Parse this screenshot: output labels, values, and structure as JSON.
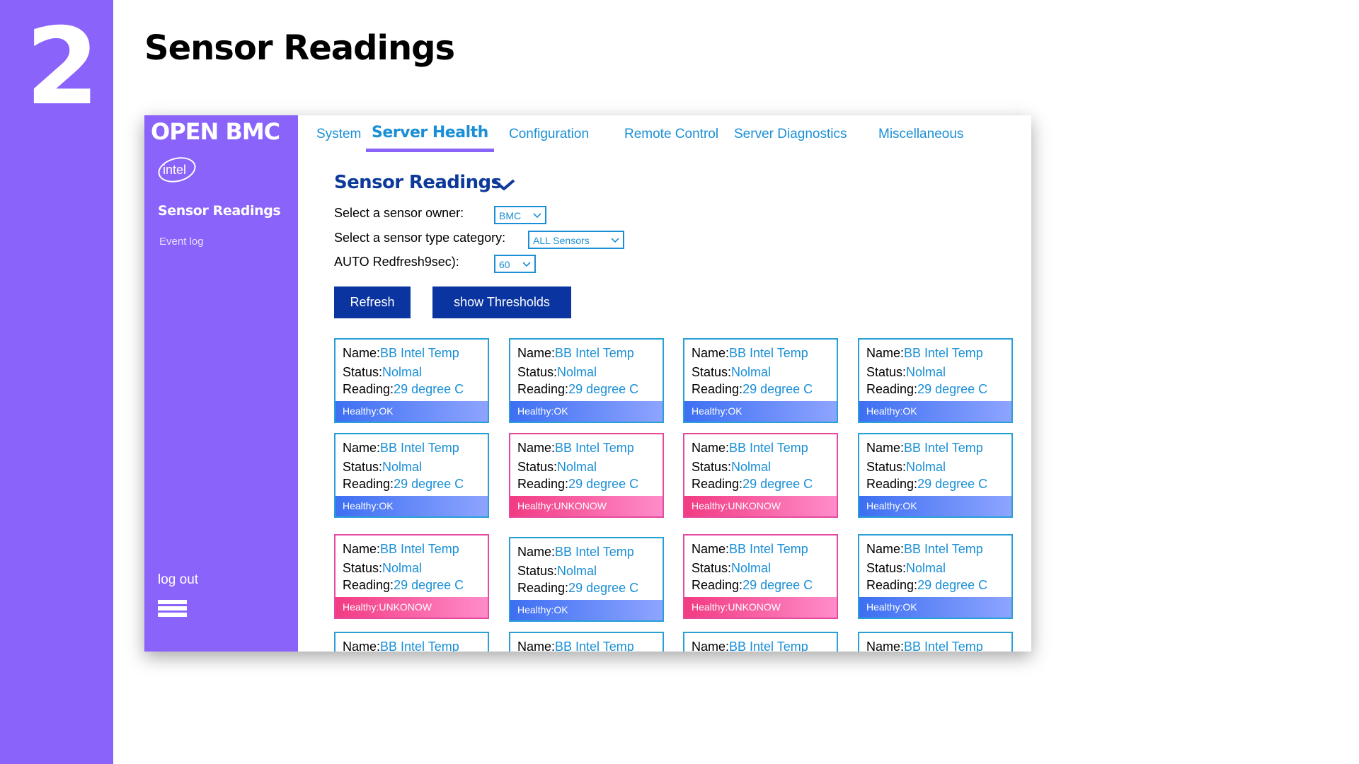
{
  "slide": {
    "number": "2",
    "title": "Sensor Readings"
  },
  "sidebar": {
    "brand": "OPEN BMC",
    "logo_text": "intel",
    "active_item": "Sensor Readings",
    "event_log": "Event log",
    "logout": "log out",
    "menu_icon": "hamburger-icon"
  },
  "tabs": [
    {
      "label": "System"
    },
    {
      "label": "Server Health",
      "active": true
    },
    {
      "label": "Configuration"
    },
    {
      "label": "Remote Control"
    },
    {
      "label": "Server Diagnostics"
    },
    {
      "label": "Miscellaneous"
    }
  ],
  "main": {
    "title": "Sensor Readings",
    "owner_label": "Select a sensor owner:",
    "owner_value": "BMC",
    "type_label": "Select a sensor type category:",
    "type_value": "ALL Sensors",
    "auto_label": "AUTO Redfresh9sec):",
    "auto_value": "60",
    "refresh_button": "Refresh",
    "thresholds_button": "show Thresholds"
  },
  "card_labels": {
    "name": "Name:",
    "status": "Status:",
    "reading": "Reading:"
  },
  "cards": [
    {
      "name": "BB Intel Temp",
      "status": "Nolmal",
      "reading": "29 degree C",
      "health": "Healthy:OK"
    },
    {
      "name": "BB Intel Temp",
      "status": "Nolmal",
      "reading": "29 degree C",
      "health": "Healthy:OK"
    },
    {
      "name": "BB Intel Temp",
      "status": "Nolmal",
      "reading": "29 degree C",
      "health": "Healthy:OK"
    },
    {
      "name": "BB Intel Temp",
      "status": "Nolmal",
      "reading": "29 degree C",
      "health": "Healthy:OK"
    },
    {
      "name": "BB Intel Temp",
      "status": "Nolmal",
      "reading": "29 degree C",
      "health": "Healthy:OK"
    },
    {
      "name": "BB Intel Temp",
      "status": "Nolmal",
      "reading": "29 degree C",
      "health": "Healthy:UNKONOW"
    },
    {
      "name": "BB Intel Temp",
      "status": "Nolmal",
      "reading": "29 degree C",
      "health": "Healthy:UNKONOW"
    },
    {
      "name": "BB Intel Temp",
      "status": "Nolmal",
      "reading": "29 degree C",
      "health": "Healthy:OK"
    },
    {
      "name": "BB Intel Temp",
      "status": "Nolmal",
      "reading": "29 degree C",
      "health": "Healthy:UNKONOW"
    },
    {
      "name": "BB Intel Temp",
      "status": "Nolmal",
      "reading": "29 degree C",
      "health": "Healthy:OK"
    },
    {
      "name": "BB Intel Temp",
      "status": "Nolmal",
      "reading": "29 degree C",
      "health": "Healthy:UNKONOW"
    },
    {
      "name": "BB Intel Temp",
      "status": "Nolmal",
      "reading": "29 degree C",
      "health": "Healthy:OK"
    },
    {
      "name": "BB Intel Temp"
    },
    {
      "name": "BB Intel Temp"
    },
    {
      "name": "BB Intel Temp"
    },
    {
      "name": "BB Intel Temp"
    }
  ],
  "colors": {
    "purple": "#8a63fb",
    "accent_blue": "#1a8fd6",
    "button_navy": "#0a35a0",
    "ok_blue": "#3d6ff2",
    "warn_pink": "#f23b82"
  }
}
